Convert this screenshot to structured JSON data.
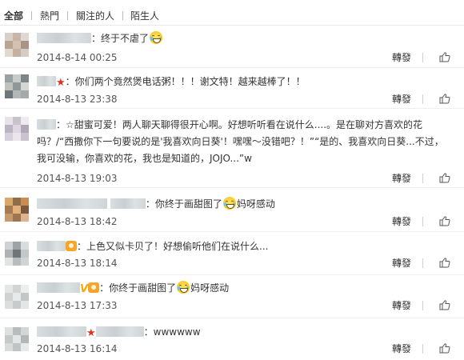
{
  "tabs": [
    {
      "label": "全部",
      "active": true
    },
    {
      "label": "熱門",
      "active": false
    },
    {
      "label": "關注的人",
      "active": false
    },
    {
      "label": "陌生人",
      "active": false
    }
  ],
  "colors": {
    "text": "#333333",
    "star": "#e5301c",
    "vip": "#f4a900",
    "divider": "#eeeeee"
  },
  "comments": [
    {
      "pre": "：终于不虐了",
      "post": "",
      "time": "2014-8-14 00:25",
      "repost": "轉發",
      "like_icon": "thumbs-up-icon",
      "emoji": "laugh-cry-emoji"
    },
    {
      "pre": "：你们两个竟然煲电话粥！！！谢文特！越来越棒了！！",
      "post": "",
      "time": "2014-8-13 23:38",
      "repost": "轉發",
      "like_icon": "thumbs-up-icon",
      "badge": "red-star-icon"
    },
    {
      "pre": "：☆甜蜜可爱！两人聊天聊得很开心啊。好想听听看在说什么....。是在聊对方喜欢的花吗？/“西撒你下一句要说的是'我喜欢向日葵'！嘿嘿～没错吧？！”“是的、我喜欢向日葵...不过，我可没输，你喜欢的花，我也是知道的，JOJO...”w",
      "post": "",
      "time": "2014-8-13 19:03",
      "repost": "轉發",
      "like_icon": "thumbs-up-icon"
    },
    {
      "pre": "：你终于画甜图了",
      "post": "妈呀感动",
      "time": "2014-8-13 18:42",
      "repost": "轉發",
      "like_icon": "thumbs-up-icon",
      "emoji": "laugh-cry-emoji"
    },
    {
      "pre": "：上色又似卡贝了！好想偷听他们在说什么...",
      "post": "",
      "time": "2014-8-13 18:14",
      "repost": "轉發",
      "like_icon": "thumbs-up-icon",
      "badge": "member-icon"
    },
    {
      "pre": "：你终于画甜图了",
      "post": "妈呀感动",
      "time": "2014-8-13 17:33",
      "repost": "轉發",
      "like_icon": "thumbs-up-icon",
      "emoji": "laugh-cry-emoji",
      "badge": "vip-member-icon"
    },
    {
      "pre": "：wwwwww",
      "post": "",
      "time": "2014-8-13 16:14",
      "repost": "轉發",
      "like_icon": "thumbs-up-icon",
      "badge": "red-star-icon"
    }
  ]
}
